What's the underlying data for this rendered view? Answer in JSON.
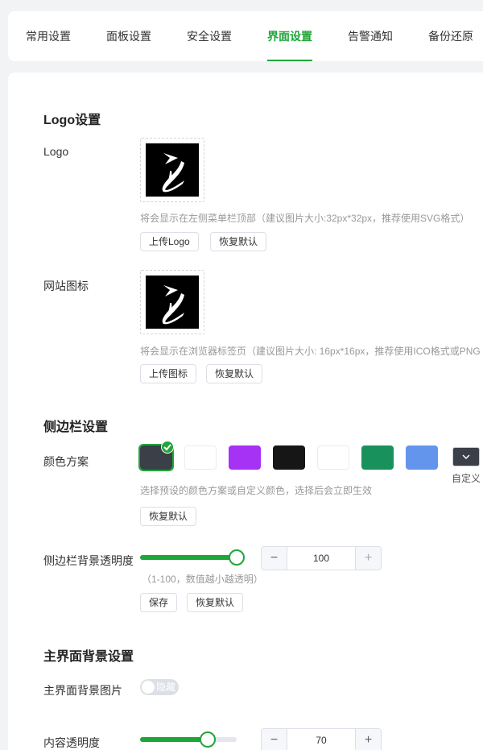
{
  "tabs": [
    {
      "label": "常用设置"
    },
    {
      "label": "面板设置"
    },
    {
      "label": "安全设置"
    },
    {
      "label": "界面设置",
      "active": true
    },
    {
      "label": "告警通知"
    },
    {
      "label": "备份还原"
    }
  ],
  "logo_section": {
    "title": "Logo设置",
    "logo": {
      "label": "Logo",
      "hint": "将会显示在左侧菜单栏顶部（建议图片大小:32px*32px，推荐使用SVG格式）",
      "upload_btn": "上传Logo",
      "reset_btn": "恢复默认"
    },
    "favicon": {
      "label": "网站图标",
      "hint": "将会显示在浏览器标签页（建议图片大小: 16px*16px，推荐使用ICO格式或PNG",
      "upload_btn": "上传图标",
      "reset_btn": "恢复默认"
    }
  },
  "sidebar_section": {
    "title": "侧边栏设置",
    "color_scheme": {
      "label": "颜色方案",
      "swatches": [
        "#3a3f48",
        "#ffffff",
        "#a532f5",
        "#161616",
        "#ffffff",
        "#19915c",
        "#6495ed"
      ],
      "selected_index": 0,
      "custom_label": "自定义",
      "hint": "选择预设的颜色方案或自定义颜色，选择后会立即生效",
      "reset_btn": "恢复默认"
    },
    "opacity": {
      "label": "侧边栏背景透明度",
      "value": "100",
      "range_hint": "（1-100，数值越小越透明）",
      "save_btn": "保存",
      "reset_btn": "恢复默认"
    }
  },
  "main_bg_section": {
    "title": "主界面背景设置",
    "bg_image": {
      "label": "主界面背景图片",
      "toggle_text": "隐藏"
    },
    "content_opacity": {
      "label": "内容透明度",
      "value": "70"
    }
  },
  "colors": {
    "accent": "#20a53a"
  }
}
